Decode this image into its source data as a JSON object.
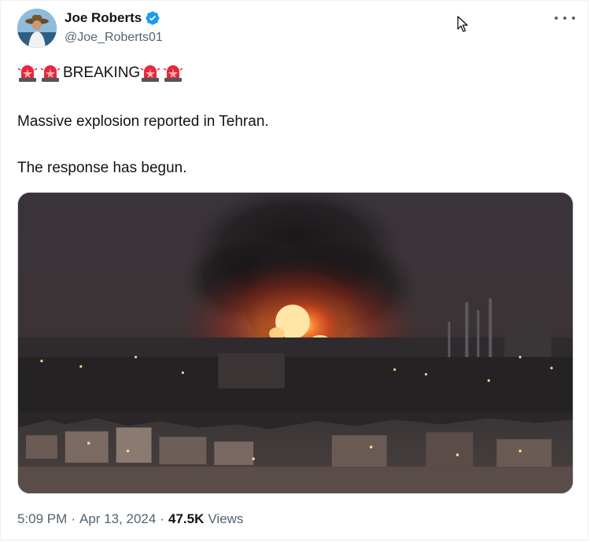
{
  "author": {
    "name": "Joe Roberts",
    "handle": "@Joe_Roberts01",
    "verified": true,
    "verified_color": "#1d9bf0"
  },
  "tweet": {
    "headline": "BREAKING",
    "headline_emoji": "police-car-light",
    "line1": "Massive explosion reported in Tehran.",
    "line2": "The response has begun."
  },
  "meta": {
    "time": "5:09 PM",
    "separator": "·",
    "date": "Apr 13, 2024",
    "views_count": "47.5K",
    "views_label": "Views"
  },
  "icons": {
    "more": "more-options-icon",
    "verified": "verified-badge-icon",
    "cursor": "mouse-pointer-icon"
  }
}
